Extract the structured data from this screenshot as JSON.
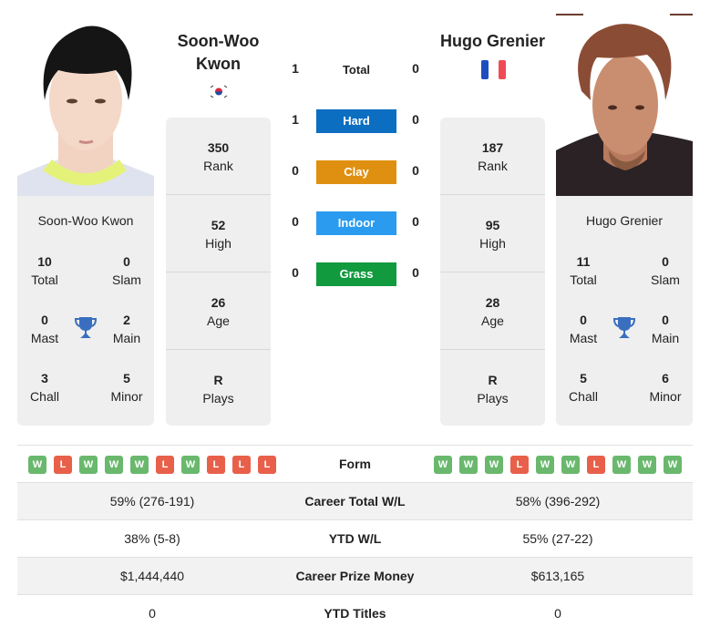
{
  "players": {
    "left": {
      "name": "Soon-Woo Kwon",
      "name_line1": "Soon-Woo",
      "name_line2": "Kwon",
      "country_flag": "south-korea-flag",
      "rank": "350",
      "rank_label": "Rank",
      "high": "52",
      "high_label": "High",
      "age": "26",
      "age_label": "Age",
      "plays": "R",
      "plays_label": "Plays",
      "titles": {
        "total": "10",
        "total_label": "Total",
        "slam": "0",
        "slam_label": "Slam",
        "mast": "0",
        "mast_label": "Mast",
        "main": "2",
        "main_label": "Main",
        "chall": "3",
        "chall_label": "Chall",
        "minor": "5",
        "minor_label": "Minor"
      },
      "form": [
        "W",
        "L",
        "W",
        "W",
        "W",
        "L",
        "W",
        "L",
        "L",
        "L"
      ]
    },
    "right": {
      "name": "Hugo Grenier",
      "country_flag": "france-flag",
      "rank": "187",
      "rank_label": "Rank",
      "high": "95",
      "high_label": "High",
      "age": "28",
      "age_label": "Age",
      "plays": "R",
      "plays_label": "Plays",
      "titles": {
        "total": "11",
        "total_label": "Total",
        "slam": "0",
        "slam_label": "Slam",
        "mast": "0",
        "mast_label": "Mast",
        "main": "0",
        "main_label": "Main",
        "chall": "5",
        "chall_label": "Chall",
        "minor": "6",
        "minor_label": "Minor"
      },
      "form": [
        "W",
        "W",
        "W",
        "L",
        "W",
        "W",
        "L",
        "W",
        "W",
        "W"
      ]
    }
  },
  "h2h": [
    {
      "label": "Total",
      "left": "1",
      "right": "0",
      "color": ""
    },
    {
      "label": "Hard",
      "left": "1",
      "right": "0",
      "color": "#0b6ec1"
    },
    {
      "label": "Clay",
      "left": "0",
      "right": "0",
      "color": "#e09010"
    },
    {
      "label": "Indoor",
      "left": "0",
      "right": "0",
      "color": "#2b9bef"
    },
    {
      "label": "Grass",
      "left": "0",
      "right": "0",
      "color": "#119a3e"
    }
  ],
  "comparison": {
    "form_label": "Form",
    "rows": [
      {
        "label": "Career Total W/L",
        "left": "59% (276-191)",
        "right": "58% (396-292)"
      },
      {
        "label": "YTD W/L",
        "left": "38% (5-8)",
        "right": "55% (27-22)"
      },
      {
        "label": "Career Prize Money",
        "left": "$1,444,440",
        "right": "$613,165"
      },
      {
        "label": "YTD Titles",
        "left": "0",
        "right": "0"
      }
    ]
  },
  "colors": {
    "win": "#6ab86e",
    "loss": "#e8604a",
    "trophy": "#3a6fbf"
  }
}
